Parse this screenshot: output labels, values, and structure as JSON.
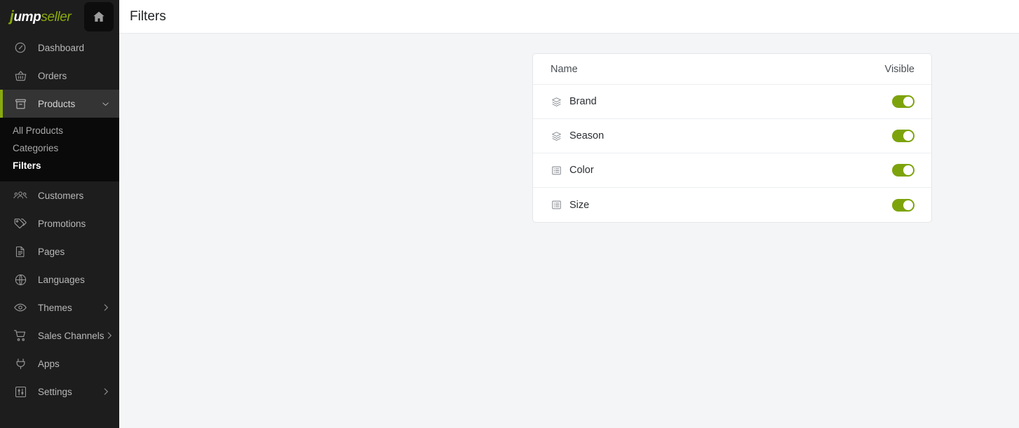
{
  "brand": {
    "logo_j": "j",
    "logo_ump": "ump",
    "logo_seller": "seller",
    "home_icon": "home-icon",
    "accent_green": "#8aab0d"
  },
  "sidebar": {
    "items": [
      {
        "label": "Dashboard",
        "icon": "gauge-icon",
        "active": false,
        "has_chevron": false,
        "chevron": ""
      },
      {
        "label": "Orders",
        "icon": "basket-icon",
        "active": false,
        "has_chevron": false,
        "chevron": ""
      },
      {
        "label": "Products",
        "icon": "box-icon",
        "active": true,
        "has_chevron": true,
        "chevron": "chevron-down-icon"
      },
      {
        "label": "Customers",
        "icon": "users-icon",
        "active": false,
        "has_chevron": false,
        "chevron": ""
      },
      {
        "label": "Promotions",
        "icon": "tags-icon",
        "active": false,
        "has_chevron": false,
        "chevron": ""
      },
      {
        "label": "Pages",
        "icon": "document-icon",
        "active": false,
        "has_chevron": false,
        "chevron": ""
      },
      {
        "label": "Languages",
        "icon": "globe-icon",
        "active": false,
        "has_chevron": false,
        "chevron": ""
      },
      {
        "label": "Themes",
        "icon": "eye-icon",
        "active": false,
        "has_chevron": true,
        "chevron": "chevron-right-icon"
      },
      {
        "label": "Sales Channels",
        "icon": "cart-icon",
        "active": false,
        "has_chevron": true,
        "chevron": "chevron-right-icon"
      },
      {
        "label": "Apps",
        "icon": "plug-icon",
        "active": false,
        "has_chevron": false,
        "chevron": ""
      },
      {
        "label": "Settings",
        "icon": "sliders-icon",
        "active": false,
        "has_chevron": true,
        "chevron": "chevron-right-icon"
      }
    ],
    "submenu": [
      {
        "label": "All Products",
        "active": false
      },
      {
        "label": "Categories",
        "active": false
      },
      {
        "label": "Filters",
        "active": true
      }
    ]
  },
  "header": {
    "title": "Filters"
  },
  "filters_table": {
    "columns": {
      "name": "Name",
      "visible": "Visible"
    },
    "rows": [
      {
        "name": "Brand",
        "icon": "layers-icon",
        "visible": true
      },
      {
        "name": "Season",
        "icon": "layers-icon",
        "visible": true
      },
      {
        "name": "Color",
        "icon": "list-icon",
        "visible": true
      },
      {
        "name": "Size",
        "icon": "list-icon",
        "visible": true
      }
    ]
  }
}
